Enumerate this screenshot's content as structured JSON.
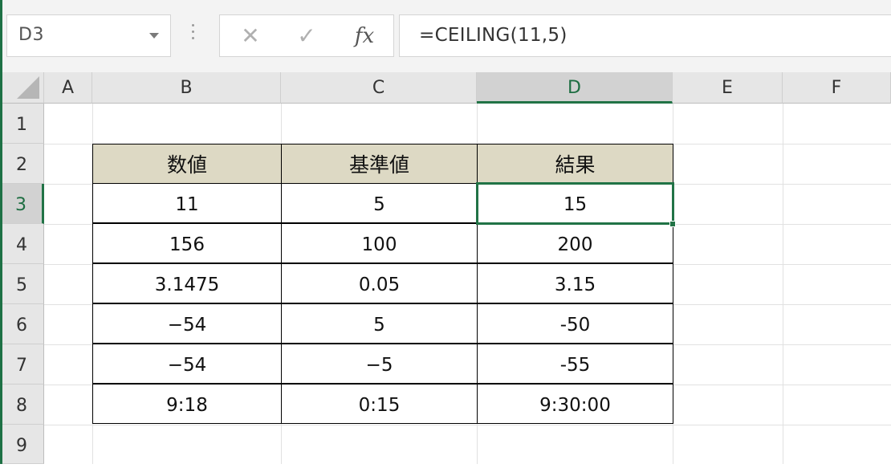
{
  "name_box": {
    "value": "D3"
  },
  "formula_bar": {
    "formula": "=CEILING(11,5)",
    "fx_label": "fx",
    "cancel_glyph": "✕",
    "enter_glyph": "✓"
  },
  "columns": [
    "A",
    "B",
    "C",
    "D",
    "E",
    "F"
  ],
  "rows": [
    "1",
    "2",
    "3",
    "4",
    "5",
    "6",
    "7",
    "8",
    "9"
  ],
  "active_cell": {
    "column": "D",
    "row": "3"
  },
  "table": {
    "headers": [
      "数値",
      "基準値",
      "結果"
    ],
    "rows": [
      [
        "11",
        "5",
        "15"
      ],
      [
        "156",
        "100",
        "200"
      ],
      [
        "3.1475",
        "0.05",
        "3.15"
      ],
      [
        "−54",
        "5",
        "-50"
      ],
      [
        "−54",
        "−5",
        "-55"
      ],
      [
        "9:18",
        "0:15",
        "9:30:00"
      ]
    ]
  },
  "colors": {
    "accent": "#217346",
    "header_fill": "#ddd9c4"
  }
}
